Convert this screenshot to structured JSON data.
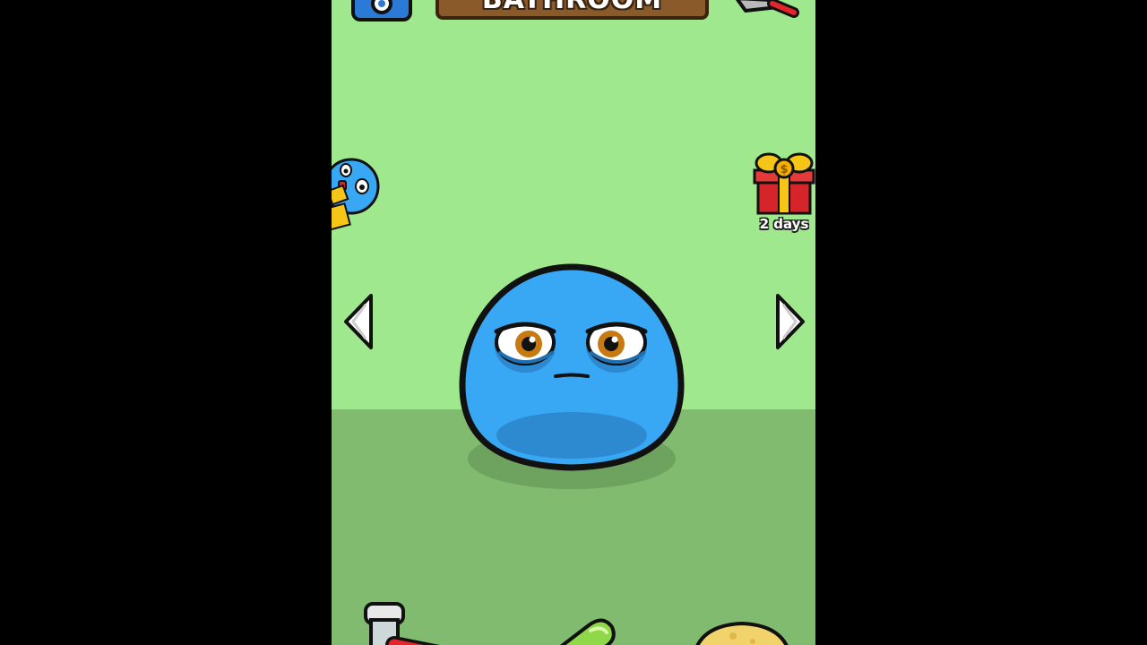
{
  "header": {
    "room_title": "BATHROOM"
  },
  "gift": {
    "countdown_label": "2 days"
  },
  "colors": {
    "background": "#9fe88e",
    "floor": "#80bb70",
    "pet_body": "#38a8f5",
    "outline": "#111111",
    "sign_wood": "#8a5a2b",
    "gift_red": "#d6242b",
    "gift_ribbon": "#f5c518"
  },
  "icons": {
    "camera": "camera-icon",
    "tools": "wrench-icon",
    "friend_invite": "friend-avatar-icon",
    "gift": "gift-box-icon",
    "prev": "arrow-left-icon",
    "next": "arrow-right-icon",
    "soap": "soap-icon",
    "pill": "pill-icon",
    "potion": "potion-bottle-icon"
  }
}
